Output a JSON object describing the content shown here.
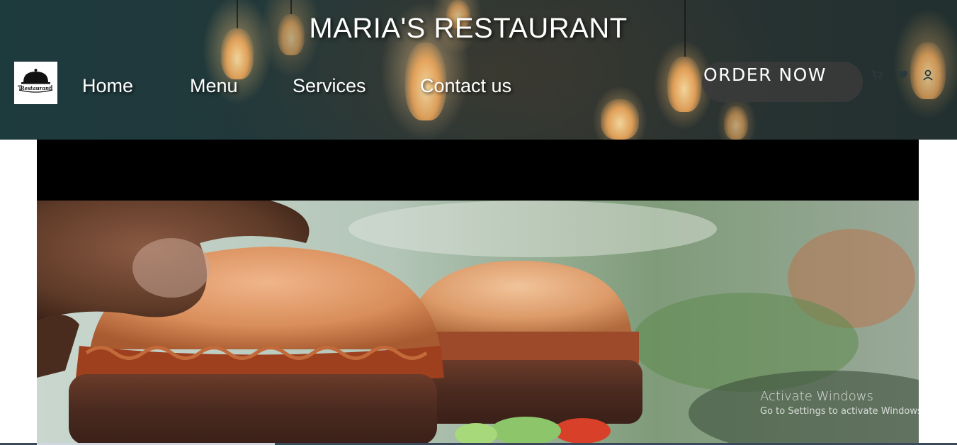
{
  "header": {
    "site_title": "MARIA'S RESTAURANT",
    "logo_text": "Restaurant",
    "nav": [
      {
        "label": "Home"
      },
      {
        "label": "Menu"
      },
      {
        "label": "Services"
      },
      {
        "label": "Contact us"
      }
    ],
    "order_button": "ORDER NOW",
    "icons": [
      "cart-icon",
      "heart-icon",
      "user-icon"
    ]
  },
  "hero": {
    "subject": "burger-video-frame"
  },
  "os_watermark": {
    "title": "Activate Windows",
    "subtitle": "Go to Settings to activate Windows."
  },
  "video": {
    "progress": 0.27
  },
  "colors": {
    "header_bg": "#1d3a3d",
    "button_bg": "#3a3a3a",
    "text": "#ffffff"
  }
}
